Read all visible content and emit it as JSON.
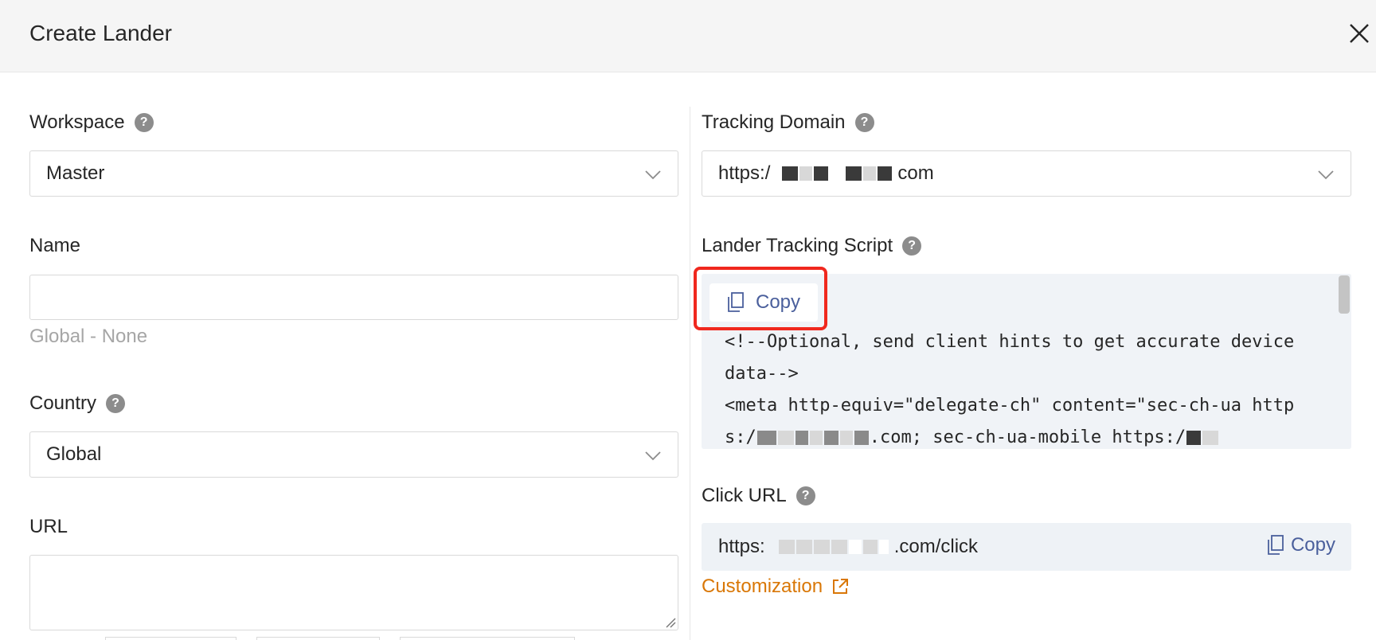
{
  "header": {
    "title": "Create Lander",
    "close_icon": "close-icon"
  },
  "left": {
    "workspace": {
      "label": "Workspace",
      "value": "Master"
    },
    "name": {
      "label": "Name",
      "value": "",
      "hint": "Global - None"
    },
    "country": {
      "label": "Country",
      "value": "Global"
    },
    "url": {
      "label": "URL",
      "value": ""
    }
  },
  "right": {
    "tracking_domain": {
      "label": "Tracking Domain",
      "value_prefix": "https:/",
      "value_suffix": "com"
    },
    "tracking_script": {
      "label": "Lander Tracking Script",
      "copy_label": "Copy",
      "line1": "<!--Optional, send client hints to get accurate device data-->",
      "line2a": "<meta http-equiv=\"delegate-ch\" content=\"sec-ch-ua htt",
      "line2b": "ps:/",
      "line2c": ".com; sec-ch-ua-mobile https:/"
    },
    "click_url": {
      "label": "Click URL",
      "value_prefix": "https:",
      "value_suffix": ".com/click",
      "copy_label": "Copy",
      "customization_label": "Customization"
    }
  },
  "colors": {
    "accent_link": "#4a5f9c",
    "customization": "#d97706",
    "highlight_border": "#f0281e"
  }
}
